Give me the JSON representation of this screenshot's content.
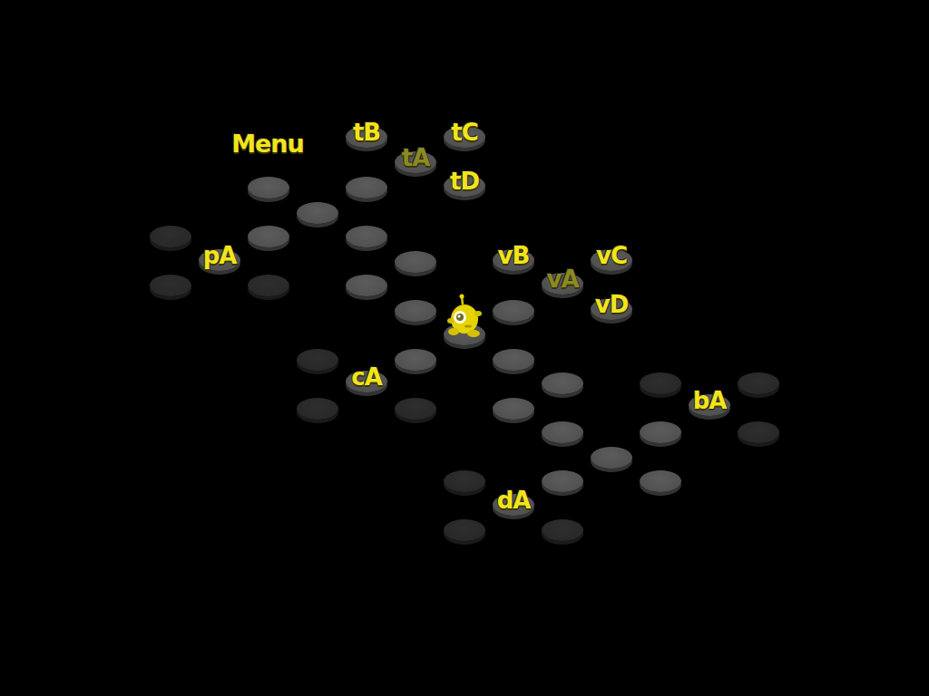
{
  "screen": {
    "title": "level-select"
  },
  "menu": {
    "label": "Menu"
  },
  "tiles": [
    {
      "kind": "level",
      "label": "tB",
      "dimmed": false,
      "player": false
    },
    {
      "kind": "level",
      "label": "tA",
      "dimmed": true,
      "player": false
    },
    {
      "kind": "level",
      "label": "tC",
      "dimmed": false,
      "player": false
    },
    {
      "kind": "level",
      "label": "tD",
      "dimmed": false,
      "player": false
    },
    {
      "kind": "level",
      "label": "pA",
      "dimmed": false,
      "player": false
    },
    {
      "kind": "level",
      "label": "vB",
      "dimmed": false,
      "player": false
    },
    {
      "kind": "level",
      "label": "vA",
      "dimmed": true,
      "player": false
    },
    {
      "kind": "level",
      "label": "vC",
      "dimmed": false,
      "player": false
    },
    {
      "kind": "level",
      "label": "vD",
      "dimmed": false,
      "player": false
    },
    {
      "kind": "level",
      "label": "cA",
      "dimmed": false,
      "player": false
    },
    {
      "kind": "level",
      "label": "bA",
      "dimmed": false,
      "player": false
    },
    {
      "kind": "level",
      "label": "dA",
      "dimmed": false,
      "player": false
    },
    {
      "kind": "path",
      "label": "",
      "dimmed": false,
      "player": false
    },
    {
      "kind": "path",
      "label": "",
      "dimmed": false,
      "player": false
    },
    {
      "kind": "path",
      "label": "",
      "dimmed": false,
      "player": false
    },
    {
      "kind": "path",
      "label": "",
      "dimmed": false,
      "player": false
    },
    {
      "kind": "path",
      "label": "",
      "dimmed": false,
      "player": false
    },
    {
      "kind": "path",
      "label": "",
      "dimmed": false,
      "player": false
    },
    {
      "kind": "path",
      "label": "",
      "dimmed": false,
      "player": false
    },
    {
      "kind": "path",
      "label": "",
      "dimmed": false,
      "player": false
    },
    {
      "kind": "path",
      "label": "",
      "dimmed": false,
      "player": true
    },
    {
      "kind": "path",
      "label": "",
      "dimmed": false,
      "player": false
    },
    {
      "kind": "path",
      "label": "",
      "dimmed": false,
      "player": false
    },
    {
      "kind": "path",
      "label": "",
      "dimmed": false,
      "player": false
    },
    {
      "kind": "path",
      "label": "",
      "dimmed": false,
      "player": false
    },
    {
      "kind": "path",
      "label": "",
      "dimmed": false,
      "player": false
    },
    {
      "kind": "path",
      "label": "",
      "dimmed": false,
      "player": false
    },
    {
      "kind": "path",
      "label": "",
      "dimmed": false,
      "player": false
    },
    {
      "kind": "path",
      "label": "",
      "dimmed": false,
      "player": false
    },
    {
      "kind": "path",
      "label": "",
      "dimmed": false,
      "player": false
    },
    {
      "kind": "path",
      "label": "",
      "dimmed": false,
      "player": false
    },
    {
      "kind": "locked",
      "label": "",
      "dimmed": false,
      "player": false
    },
    {
      "kind": "locked",
      "label": "",
      "dimmed": false,
      "player": false
    },
    {
      "kind": "locked",
      "label": "",
      "dimmed": false,
      "player": false
    },
    {
      "kind": "locked",
      "label": "",
      "dimmed": false,
      "player": false
    },
    {
      "kind": "locked",
      "label": "",
      "dimmed": false,
      "player": false
    },
    {
      "kind": "locked",
      "label": "",
      "dimmed": false,
      "player": false
    },
    {
      "kind": "locked",
      "label": "",
      "dimmed": false,
      "player": false
    },
    {
      "kind": "locked",
      "label": "",
      "dimmed": false,
      "player": false
    },
    {
      "kind": "locked",
      "label": "",
      "dimmed": false,
      "player": false
    },
    {
      "kind": "locked",
      "label": "",
      "dimmed": false,
      "player": false
    },
    {
      "kind": "locked",
      "label": "",
      "dimmed": false,
      "player": false
    },
    {
      "kind": "locked",
      "label": "",
      "dimmed": false,
      "player": false
    }
  ]
}
